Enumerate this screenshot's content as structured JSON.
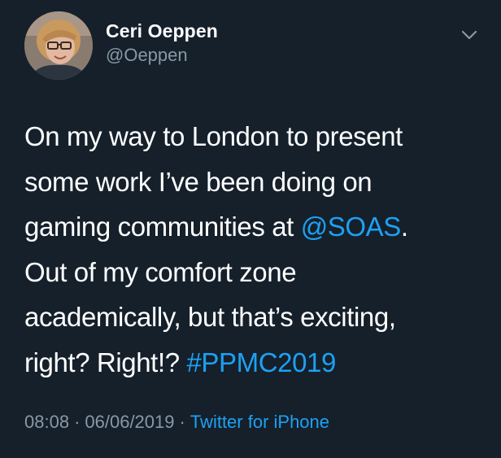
{
  "author": {
    "display_name": "Ceri Oeppen",
    "handle": "@Oeppen",
    "avatar_icon": "profile-photo"
  },
  "menu": {
    "chevron_icon": "chevron-down-icon"
  },
  "tweet": {
    "lines": [
      {
        "before": "On my way to London to present",
        "link": "",
        "after": ""
      },
      {
        "before": "some work I’ve been doing on",
        "link": "",
        "after": ""
      },
      {
        "before": "gaming communities at ",
        "link": "@SOAS",
        "after": "."
      },
      {
        "before": "Out of my comfort zone",
        "link": "",
        "after": ""
      },
      {
        "before": "academically, but that’s exciting,",
        "link": "",
        "after": ""
      },
      {
        "before": "right? Right!? ",
        "link": "#PPMC2019",
        "after": ""
      }
    ]
  },
  "meta": {
    "time": "08:08",
    "separator": "·",
    "date": "06/06/2019",
    "source": "Twitter for iPhone"
  },
  "colors": {
    "background": "#15202b",
    "text": "#ffffff",
    "secondary": "#8899a6",
    "link": "#1da1f2"
  }
}
